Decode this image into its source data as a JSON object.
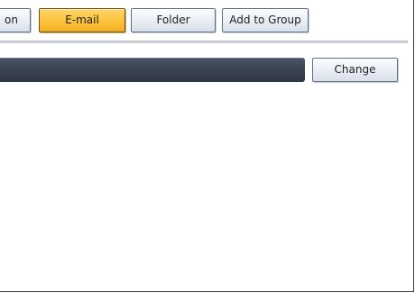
{
  "tabs": [
    {
      "label": "on",
      "selected": false
    },
    {
      "label": "E-mail",
      "selected": true
    },
    {
      "label": "Folder",
      "selected": false
    },
    {
      "label": "Add to Group",
      "selected": false
    }
  ],
  "field": {
    "value": ""
  },
  "change_button": {
    "label": "Change"
  },
  "colors": {
    "selected_tab": "#fcc23a",
    "field_background": "#3a4352",
    "button_background": "#e9edf4"
  }
}
